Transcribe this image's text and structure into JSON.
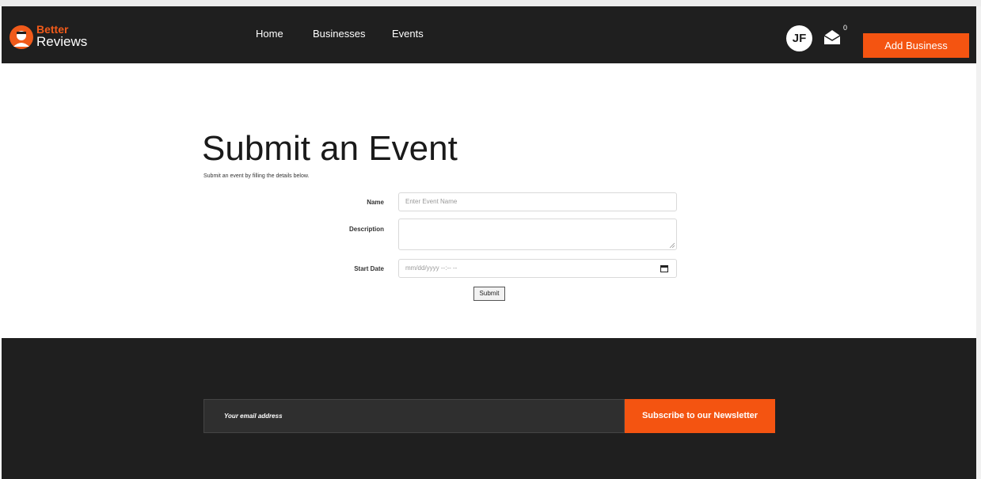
{
  "header": {
    "logo": {
      "line1": "Better",
      "line2": "Reviews"
    },
    "nav": [
      {
        "label": "Home"
      },
      {
        "label": "Businesses"
      },
      {
        "label": "Events"
      }
    ],
    "avatar_initials": "JF",
    "mail_count": "0",
    "add_business_label": "Add Business"
  },
  "main": {
    "title": "Submit an Event",
    "subtitle": "Submit an event by filling the details below.",
    "form": {
      "name_label": "Name",
      "name_placeholder": "Enter Event Name",
      "description_label": "Description",
      "start_date_label": "Start Date",
      "start_date_placeholder": "mm/dd/yyyy --:-- --",
      "submit_label": "Submit"
    }
  },
  "footer": {
    "newsletter_placeholder": "Your email address",
    "subscribe_label": "Subscribe to our Newsletter"
  },
  "colors": {
    "accent": "#f45411",
    "header_bg": "#1f1f1f"
  }
}
